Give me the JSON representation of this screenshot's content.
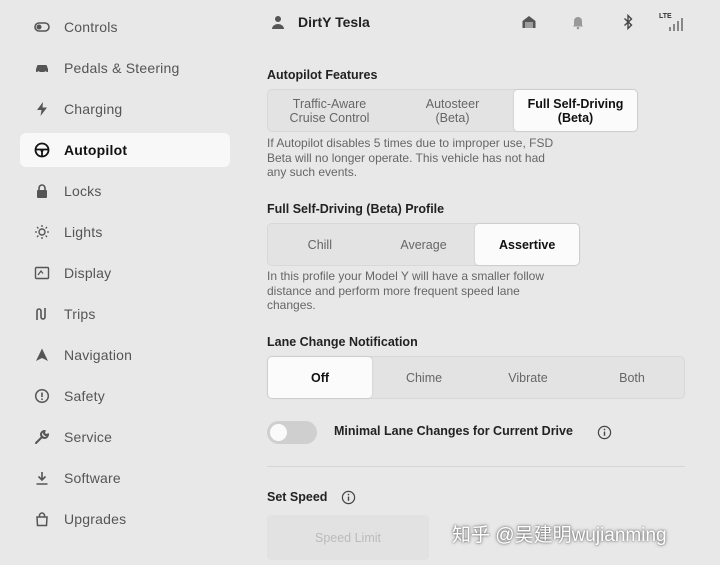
{
  "sidebar": {
    "items": [
      {
        "label": "Controls",
        "icon": "toggle-icon"
      },
      {
        "label": "Pedals & Steering",
        "icon": "car-icon"
      },
      {
        "label": "Charging",
        "icon": "bolt-icon"
      },
      {
        "label": "Autopilot",
        "icon": "steering-wheel-icon",
        "active": true
      },
      {
        "label": "Locks",
        "icon": "lock-icon"
      },
      {
        "label": "Lights",
        "icon": "sun-icon"
      },
      {
        "label": "Display",
        "icon": "display-icon"
      },
      {
        "label": "Trips",
        "icon": "trips-icon"
      },
      {
        "label": "Navigation",
        "icon": "navigation-arrow-icon"
      },
      {
        "label": "Safety",
        "icon": "alert-circle-icon"
      },
      {
        "label": "Service",
        "icon": "wrench-icon"
      },
      {
        "label": "Software",
        "icon": "download-icon"
      },
      {
        "label": "Upgrades",
        "icon": "bag-icon"
      }
    ]
  },
  "header": {
    "user_name": "DirtY Tesla",
    "lte_label": "LTE"
  },
  "autopilot_features": {
    "title": "Autopilot Features",
    "options": [
      "Traffic-Aware\nCruise Control",
      "Autosteer\n(Beta)",
      "Full Self-Driving\n(Beta)"
    ],
    "selected_index": 2,
    "description": "If Autopilot disables 5 times due to improper use, FSD Beta will no longer operate. This vehicle has not had any such events."
  },
  "fsd_profile": {
    "title": "Full Self-Driving (Beta) Profile",
    "options": [
      "Chill",
      "Average",
      "Assertive"
    ],
    "selected_index": 2,
    "description": "In this profile your Model Y will have a smaller follow distance and perform more frequent speed lane changes."
  },
  "lane_change": {
    "title": "Lane Change Notification",
    "options": [
      "Off",
      "Chime",
      "Vibrate",
      "Both"
    ],
    "selected_index": 0
  },
  "minimal_lane_changes": {
    "label": "Minimal Lane Changes for Current Drive",
    "enabled": false
  },
  "set_speed": {
    "title": "Set Speed",
    "option_label": "Speed Limit"
  },
  "watermark": "知乎 @吴建明wujianming",
  "colors": {
    "background": "#e8e8e8",
    "selected_bg": "#fbfbfb",
    "text_dark": "#222222",
    "text_muted": "#666666"
  }
}
